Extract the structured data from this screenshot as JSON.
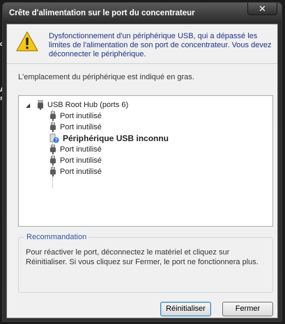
{
  "background": {
    "fragments": [
      "d'",
      "A",
      "si"
    ]
  },
  "window": {
    "title": "Crête d'alimentation sur le port du concentrateur",
    "close_glyph": "✕"
  },
  "warning": {
    "icon": "warning-icon",
    "message": "Dysfonctionnement d'un périphérique USB, qui a dépassé les limites de l'alimentation de son port de concentrateur. Vous devez déconnecter le périphérique."
  },
  "info": "L'emplacement du périphérique est indiqué en gras.",
  "tree": {
    "root": {
      "label": "USB Root Hub (ports 6)",
      "icon": "usb-hub-icon",
      "toggle": "◢"
    },
    "items": [
      {
        "label": "Port inutilisé",
        "icon": "usb-port-icon",
        "bold": false
      },
      {
        "label": "Port inutilisé",
        "icon": "usb-port-icon",
        "bold": false
      },
      {
        "label": "Périphérique USB inconnu",
        "icon": "unknown-device-icon",
        "bold": true
      },
      {
        "label": "Port inutilisé",
        "icon": "usb-port-icon",
        "bold": false
      },
      {
        "label": "Port inutilisé",
        "icon": "usb-port-icon",
        "bold": false
      },
      {
        "label": "Port inutilisé",
        "icon": "usb-port-icon",
        "bold": false
      }
    ]
  },
  "recommendation": {
    "title": "Recommandation",
    "text": "Pour réactiver le port, déconnectez le matériel et cliquez sur Réinitialiser. Si vous cliquez sur Fermer, le port ne fonctionnera plus."
  },
  "buttons": {
    "reset": "Réinitialiser",
    "close": "Fermer"
  }
}
